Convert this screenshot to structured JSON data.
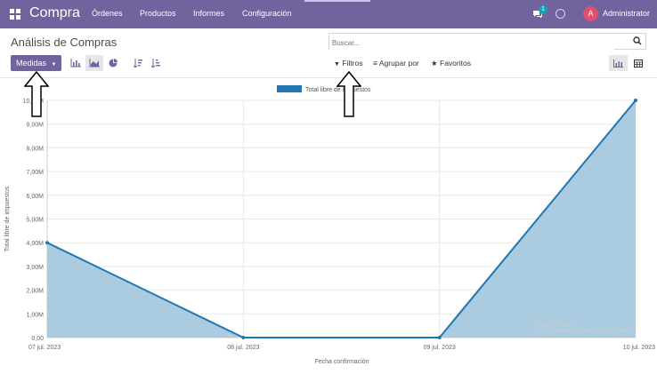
{
  "navbar": {
    "brand": "Compra",
    "menu": [
      "Órdenes",
      "Productos",
      "Informes",
      "Configuración"
    ],
    "chat_badge": "1",
    "avatar_letter": "A",
    "user": "Administrator"
  },
  "control_panel": {
    "title": "Análisis de Compras",
    "measures_label": "Medidas",
    "search_placeholder": "Buscar...",
    "filters_label": "Filtros",
    "groupby_label": "Agrupar por",
    "favorites_label": "Favoritos"
  },
  "chart_data": {
    "type": "area",
    "x": [
      "07 jul. 2023",
      "08 jul. 2023",
      "09 jul. 2023",
      "10 jul. 2023"
    ],
    "series": [
      {
        "name": "Total libre de impuestos",
        "values": [
          4000000,
          0,
          0,
          10000000
        ]
      }
    ],
    "xlabel": "Fecha confirmación",
    "ylabel": "Total libre de impuestos",
    "ylim": [
      0,
      10000000
    ],
    "yticks": [
      "0,00",
      "1,00M",
      "2,00M",
      "3,00M",
      "4,00M",
      "5,00M",
      "6,00M",
      "7,00M",
      "8,00M",
      "9,00M",
      "10,00M"
    ],
    "grid": true,
    "legend": "top-center",
    "color": "#1f77b4",
    "fill_color": "#a6c8df"
  },
  "watermark": {
    "line1": "Activar Windows",
    "line2": "Ve a Configuración para activar Windows."
  }
}
